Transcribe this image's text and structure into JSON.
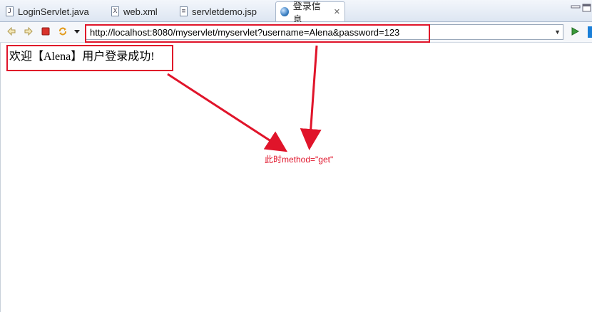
{
  "tabs": [
    {
      "label": "LoginServlet.java",
      "icon": "java-file-icon"
    },
    {
      "label": "web.xml",
      "icon": "xml-file-icon"
    },
    {
      "label": "servletdemo.jsp",
      "icon": "jsp-file-icon"
    },
    {
      "label": "登录信息",
      "icon": "globe-icon",
      "active": true
    }
  ],
  "browser": {
    "url": "http://localhost:8080/myservlet/myservlet?username=Alena&password=123"
  },
  "page": {
    "message": "欢迎【Alena】用户登录成功!"
  },
  "annotation": {
    "text": "此时method=\"get\"",
    "color": "#e0142a"
  },
  "colors": {
    "accent": "#e0142a",
    "go": "#3a9a3a",
    "stop": "#d9322b"
  }
}
